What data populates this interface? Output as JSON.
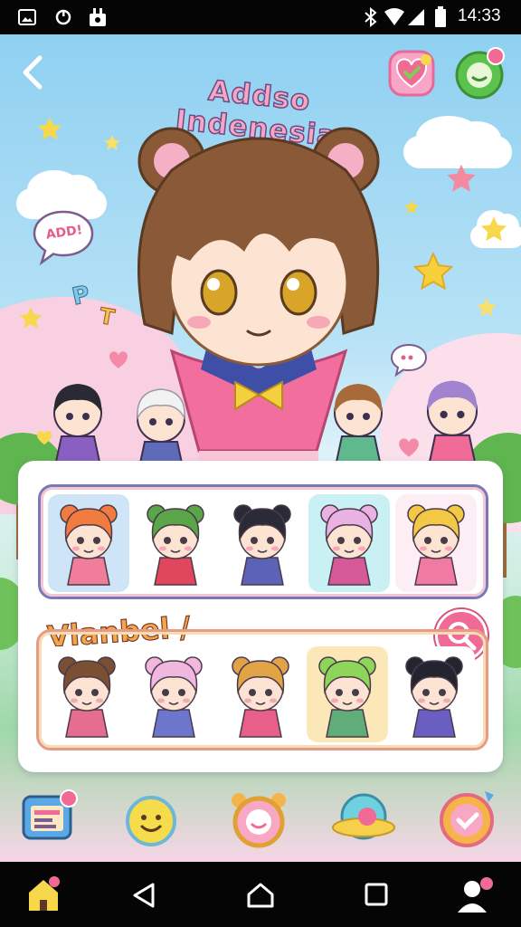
{
  "status_bar": {
    "time": "14:33",
    "icons": [
      "gallery-icon",
      "sync-icon",
      "lock-notification-icon",
      "bluetooth-icon",
      "wifi-icon",
      "signal-icon",
      "battery-icon"
    ]
  },
  "header": {
    "title": "Addso Indenesia",
    "back_icon": "chevron-left-icon",
    "right_icons": [
      "heart-icon",
      "notification-icon"
    ]
  },
  "speech_bubble": {
    "text": "ADD!"
  },
  "side_letters": [
    "P",
    "T"
  ],
  "row1": {
    "characters": [
      {
        "hair": "#f27b3f",
        "outfit": "#f07e9a",
        "slot_bg": "#cfe4f7"
      },
      {
        "hair": "#5aa548",
        "outfit": "#e0475c",
        "slot_bg": "#ffffff"
      },
      {
        "hair": "#2b2b38",
        "outfit": "#5a63b6",
        "slot_bg": "#ffffff"
      },
      {
        "hair": "#e9b2e2",
        "outfit": "#d65a98",
        "slot_bg": "#c9f0f2"
      },
      {
        "hair": "#f3c844",
        "outfit": "#f07aa2",
        "slot_bg": "#fdeef6"
      }
    ]
  },
  "row2": {
    "title": "Vlanbel /",
    "characters": [
      {
        "hair": "#7b4f33",
        "outfit": "#e56d8f",
        "slot_bg": "#ffffff"
      },
      {
        "hair": "#f1b8df",
        "outfit": "#6b76cc",
        "slot_bg": "#ffffff"
      },
      {
        "hair": "#e2a246",
        "outfit": "#e8608a",
        "slot_bg": "#ffffff"
      },
      {
        "hair": "#8ed65a",
        "outfit": "#5fae79",
        "slot_bg": "#fbe7b8"
      },
      {
        "hair": "#242430",
        "outfit": "#6a5ec2",
        "slot_bg": "#ffffff"
      }
    ]
  },
  "main_character": {
    "hair": "#8a5a38",
    "outfit": "#f26e9c",
    "bow": "#f4d03f"
  },
  "crowd": [
    {
      "hair": "#2a2a34",
      "outfit": "#8a5fc2"
    },
    {
      "hair": "#f2f2f2",
      "outfit": "#5f6bb8"
    },
    {
      "hair": "#a96a3a",
      "outfit": "#5fb98c"
    },
    {
      "hair": "#a283cf",
      "outfit": "#f06b98"
    }
  ],
  "bottom_bar": {
    "icons": [
      "tablet-menu-icon",
      "smiley-face-icon",
      "chat-ring-icon",
      "planet-icon",
      "check-badge-icon"
    ]
  },
  "nav_bar": {
    "icons": [
      "home-icon",
      "back-triangle-icon",
      "home-circle-icon",
      "recents-square-icon",
      "profile-icon"
    ]
  },
  "colors": {
    "sky": "#8fd0f1",
    "accent_pink": "#f06a95",
    "title_fill": "#f7a6c2",
    "row1_border": "#7a79b6",
    "row2_border": "#e79a86"
  }
}
